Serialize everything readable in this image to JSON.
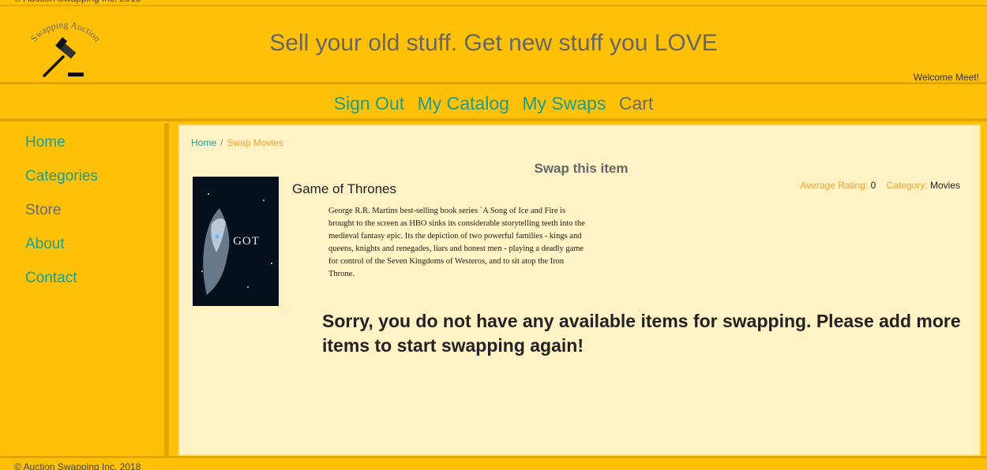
{
  "copyright": "© Auction Swapping Inc. 2018",
  "header": {
    "logo_text": "Swapping Auction",
    "tagline": "Sell your old stuff. Get new stuff you LOVE",
    "welcome": "Welcome Meet!"
  },
  "nav": {
    "items": [
      {
        "label": "Sign Out"
      },
      {
        "label": "My Catalog"
      },
      {
        "label": "My Swaps"
      },
      {
        "label": "Cart"
      }
    ]
  },
  "sidebar": {
    "items": [
      {
        "label": "Home"
      },
      {
        "label": "Categories"
      },
      {
        "label": "Store"
      },
      {
        "label": "About"
      },
      {
        "label": "Contact"
      }
    ]
  },
  "breadcrumb": {
    "home": "Home",
    "separator": "/",
    "current": "Swap Movies"
  },
  "main": {
    "title": "Swap this item",
    "item": {
      "name": "Game of Thrones",
      "poster_text": "GOT",
      "rating_label": "Average Rating:",
      "rating_value": "0",
      "category_label": "Category:",
      "category_value": "Movies",
      "description": "George R.R. Martins best-selling book series `A Song of Ice and Fire is brought to the screen as HBO sinks its considerable storytelling teeth into the medieval fantasy epic. Its the depiction of two powerful families - kings and queens, knights and renegades, liars and honest men - playing a deadly game for control of the Seven Kingdoms of Westeros, and to sit atop the Iron Throne."
    },
    "message": "Sorry, you do not have any available items for swapping. Please add more items to start swapping again!"
  },
  "colors": {
    "background": "#ffc107",
    "link": "#1a9e8f",
    "muted_link": "#6b6b6b",
    "accent": "#f0a030",
    "panel": "#fff2c4"
  }
}
